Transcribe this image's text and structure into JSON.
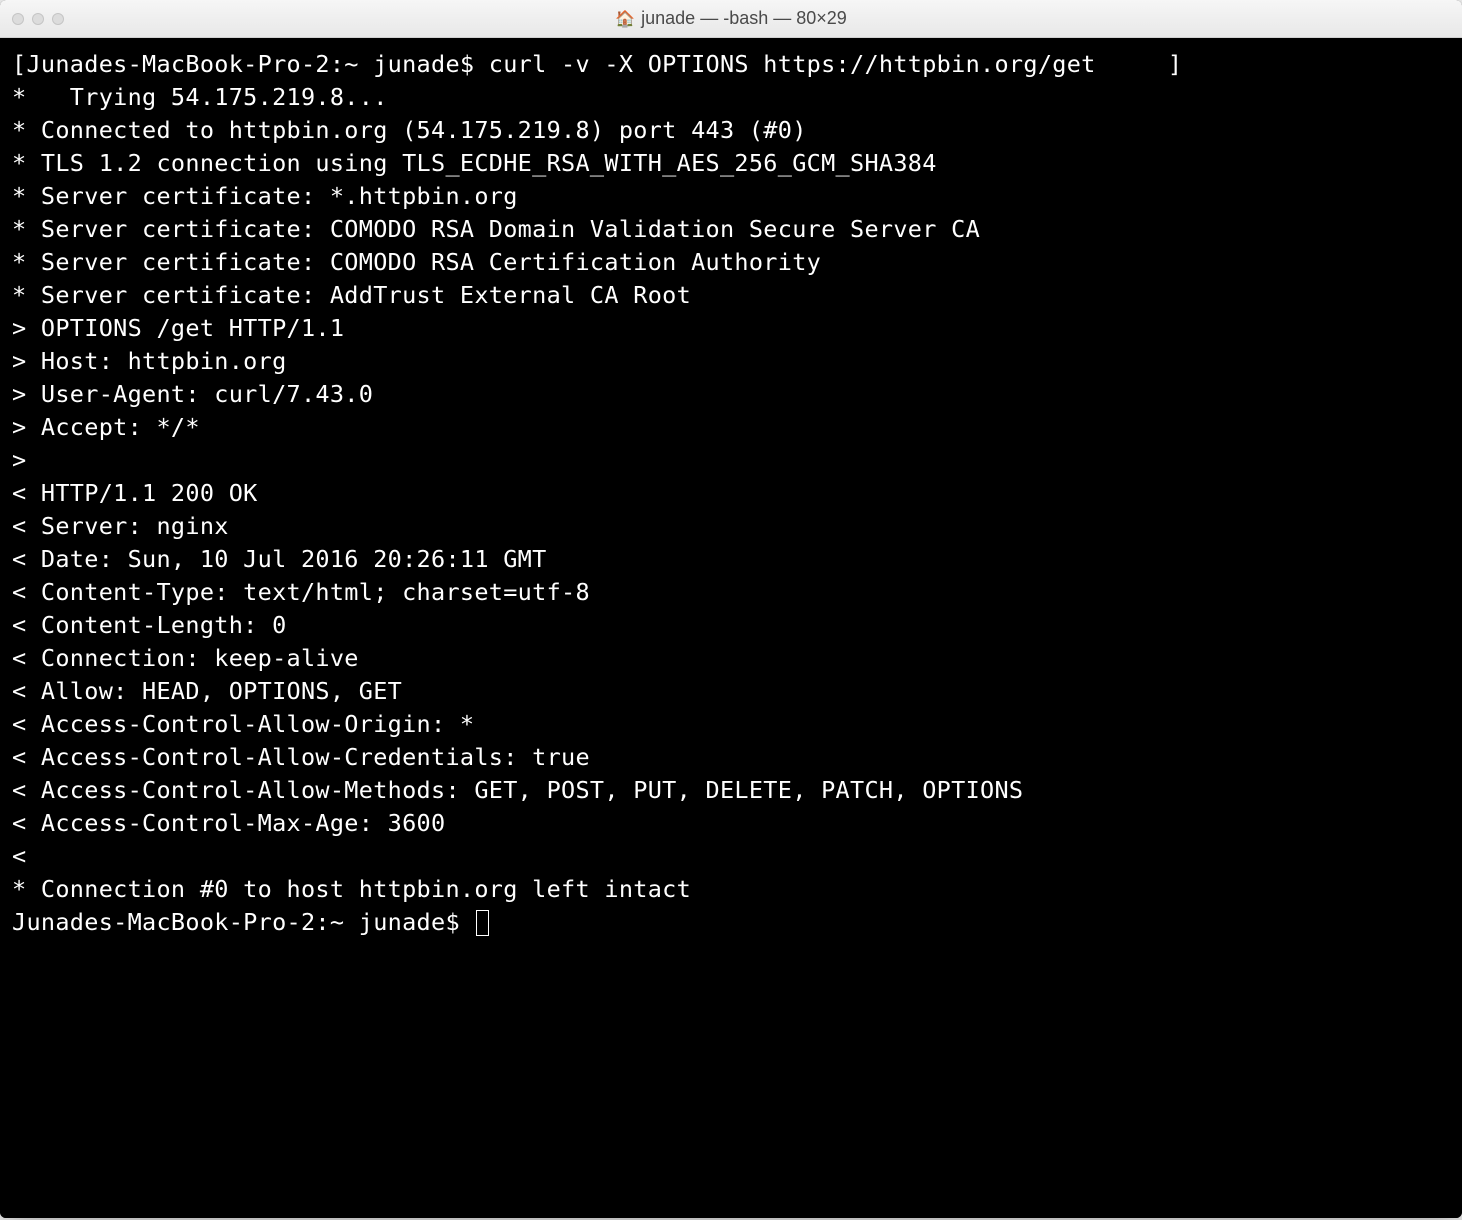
{
  "window": {
    "title": "junade — -bash — 80×29"
  },
  "terminal": {
    "prompt_bracket_open": "[",
    "prompt_bracket_close": "]",
    "lines": [
      "[Junades-MacBook-Pro-2:~ junade$ curl -v -X OPTIONS https://httpbin.org/get     ]",
      "*   Trying 54.175.219.8...",
      "* Connected to httpbin.org (54.175.219.8) port 443 (#0)",
      "* TLS 1.2 connection using TLS_ECDHE_RSA_WITH_AES_256_GCM_SHA384",
      "* Server certificate: *.httpbin.org",
      "* Server certificate: COMODO RSA Domain Validation Secure Server CA",
      "* Server certificate: COMODO RSA Certification Authority",
      "* Server certificate: AddTrust External CA Root",
      "> OPTIONS /get HTTP/1.1",
      "> Host: httpbin.org",
      "> User-Agent: curl/7.43.0",
      "> Accept: */*",
      "> ",
      "< HTTP/1.1 200 OK",
      "< Server: nginx",
      "< Date: Sun, 10 Jul 2016 20:26:11 GMT",
      "< Content-Type: text/html; charset=utf-8",
      "< Content-Length: 0",
      "< Connection: keep-alive",
      "< Allow: HEAD, OPTIONS, GET",
      "< Access-Control-Allow-Origin: *",
      "< Access-Control-Allow-Credentials: true",
      "< Access-Control-Allow-Methods: GET, POST, PUT, DELETE, PATCH, OPTIONS",
      "< Access-Control-Max-Age: 3600",
      "< ",
      "* Connection #0 to host httpbin.org left intact"
    ],
    "final_prompt": "Junades-MacBook-Pro-2:~ junade$ "
  }
}
